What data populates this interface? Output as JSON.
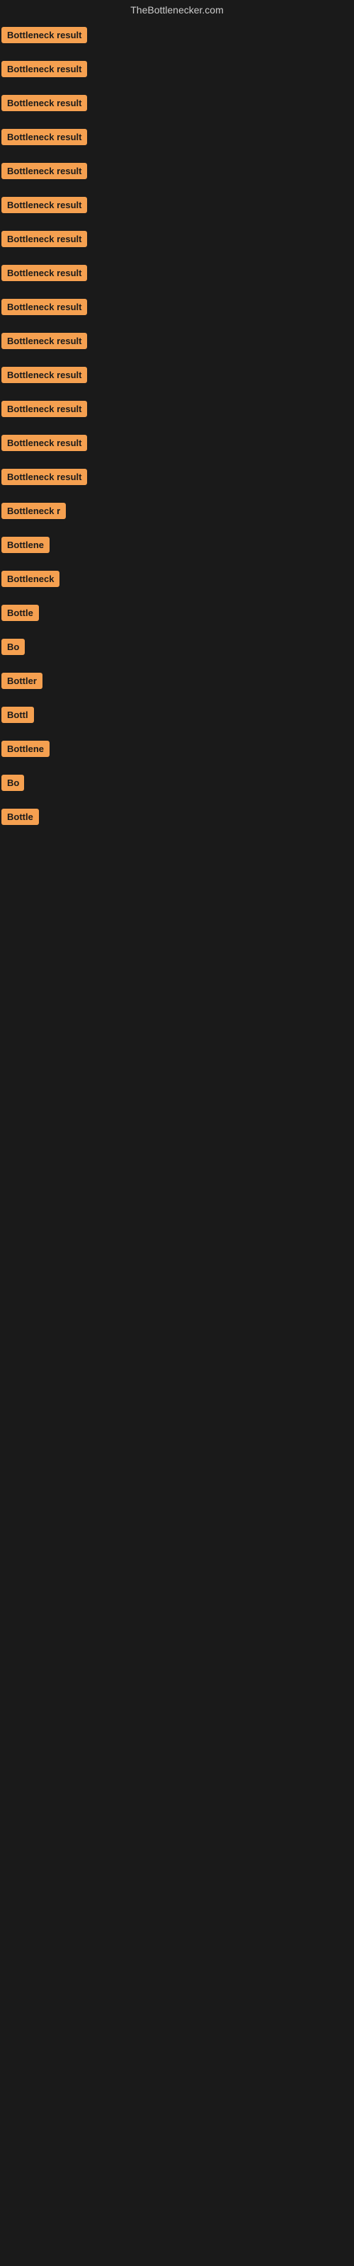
{
  "site": {
    "title": "TheBottlenecker.com"
  },
  "tags": [
    {
      "id": 1,
      "label": "Bottleneck result",
      "width": 160
    },
    {
      "id": 2,
      "label": "Bottleneck result",
      "width": 160
    },
    {
      "id": 3,
      "label": "Bottleneck result",
      "width": 160
    },
    {
      "id": 4,
      "label": "Bottleneck result",
      "width": 160
    },
    {
      "id": 5,
      "label": "Bottleneck result",
      "width": 160
    },
    {
      "id": 6,
      "label": "Bottleneck result",
      "width": 160
    },
    {
      "id": 7,
      "label": "Bottleneck result",
      "width": 160
    },
    {
      "id": 8,
      "label": "Bottleneck result",
      "width": 160
    },
    {
      "id": 9,
      "label": "Bottleneck result",
      "width": 160
    },
    {
      "id": 10,
      "label": "Bottleneck result",
      "width": 160
    },
    {
      "id": 11,
      "label": "Bottleneck result",
      "width": 160
    },
    {
      "id": 12,
      "label": "Bottleneck result",
      "width": 155
    },
    {
      "id": 13,
      "label": "Bottleneck result",
      "width": 155
    },
    {
      "id": 14,
      "label": "Bottleneck result",
      "width": 150
    },
    {
      "id": 15,
      "label": "Bottleneck r",
      "width": 95
    },
    {
      "id": 16,
      "label": "Bottlene",
      "width": 80
    },
    {
      "id": 17,
      "label": "Bottleneck",
      "width": 88
    },
    {
      "id": 18,
      "label": "Bottle",
      "width": 65
    },
    {
      "id": 19,
      "label": "Bo",
      "width": 34
    },
    {
      "id": 20,
      "label": "Bottler",
      "width": 65
    },
    {
      "id": 21,
      "label": "Bottl",
      "width": 55
    },
    {
      "id": 22,
      "label": "Bottlene",
      "width": 75
    },
    {
      "id": 23,
      "label": "Bo",
      "width": 32
    },
    {
      "id": 24,
      "label": "Bottle",
      "width": 60
    }
  ]
}
